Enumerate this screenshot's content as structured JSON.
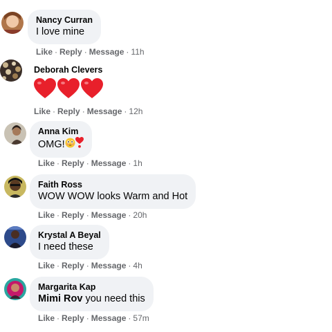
{
  "comments": [
    {
      "author": "Nancy Curran",
      "text": "I love mine",
      "like": "Like",
      "reply": "Reply",
      "message": "Message",
      "time": "11h"
    },
    {
      "author": "Deborah Clevers",
      "text": "",
      "hearts": [
        "heart-emoji",
        "heart-emoji",
        "heart-emoji"
      ],
      "like": "Like",
      "reply": "Reply",
      "message": "Message",
      "time": "12h"
    },
    {
      "author": "Anna Kim",
      "text": "OMG!",
      "emoji": [
        "flushed-face-emoji",
        "exclamation-heart-emoji"
      ],
      "like": "Like",
      "reply": "Reply",
      "message": "Message",
      "time": "1h"
    },
    {
      "author": "Faith Ross",
      "text": "WOW WOW looks Warm and Hot",
      "like": "Like",
      "reply": "Reply",
      "message": "Message",
      "time": "20h"
    },
    {
      "author": "Krystal A Beyal",
      "text": "I need these",
      "like": "Like",
      "reply": "Reply",
      "message": "Message",
      "time": "4h"
    },
    {
      "author": "Margarita Kap",
      "mention": "Mimi Rov",
      "text": "you need this",
      "like": "Like",
      "reply": "Reply",
      "message": "Message",
      "time": "57m"
    }
  ],
  "colors": {
    "bubble": "#f0f2f5",
    "meta_text": "#65676b",
    "heart": "#e8202b"
  }
}
